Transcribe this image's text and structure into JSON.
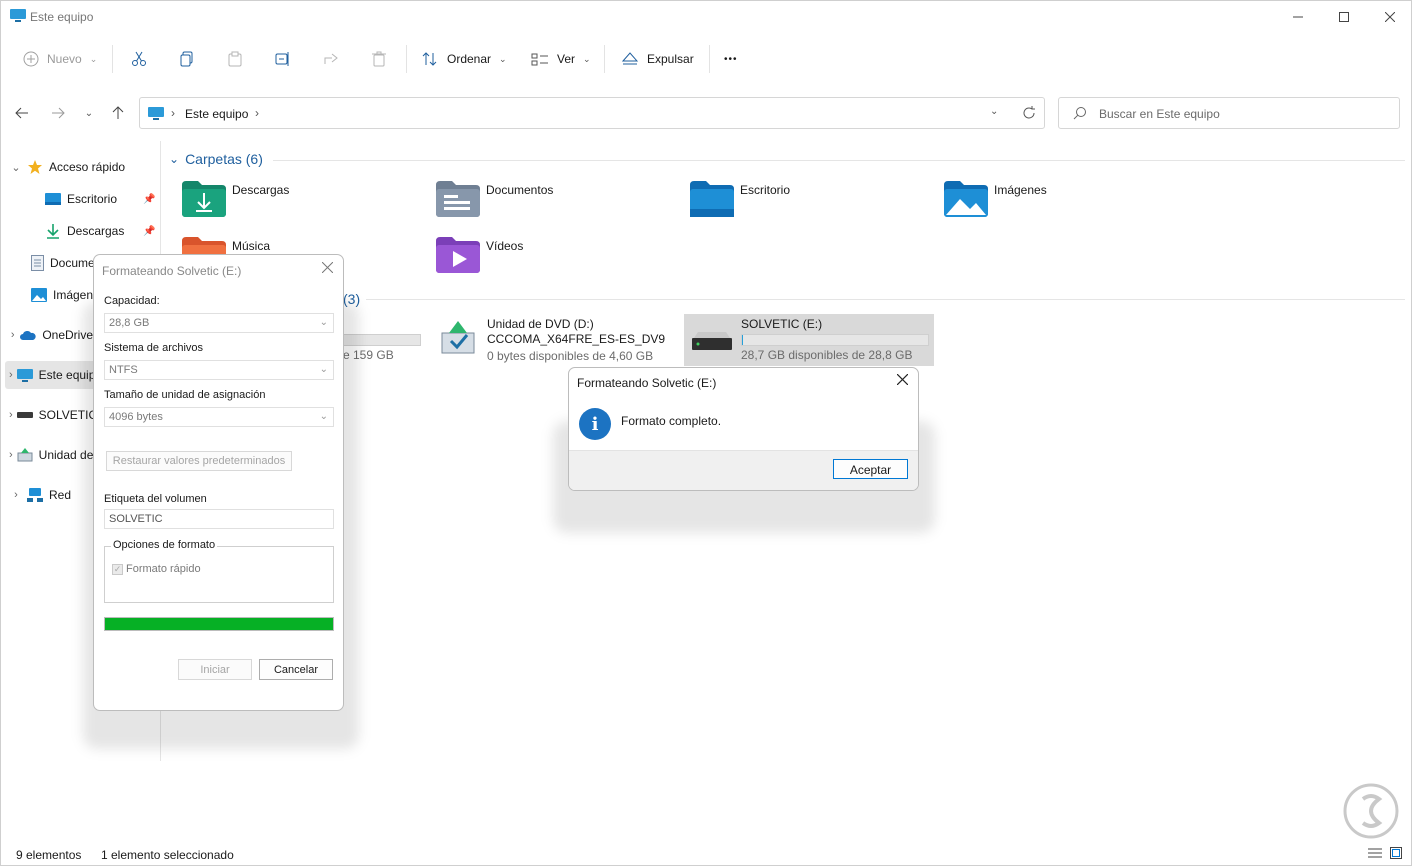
{
  "window": {
    "title": "Este equipo",
    "minimize": "—",
    "maximize": "☐",
    "close": "✕"
  },
  "toolbar": {
    "new_label": "Nuevo",
    "sort_label": "Ordenar",
    "view_label": "Ver",
    "eject_label": "Expulsar",
    "more_label": "•••"
  },
  "address": {
    "crumbs": [
      "Este equipo"
    ],
    "search_placeholder": "Buscar en Este equipo"
  },
  "nav": {
    "quick_access": "Acceso rápido",
    "items": [
      {
        "label": "Escritorio",
        "pinned": true
      },
      {
        "label": "Descargas",
        "pinned": true
      },
      {
        "label": "Documentos"
      },
      {
        "label": "Imágenes"
      }
    ],
    "onedrive": "OneDrive",
    "this_pc": "Este equipo",
    "solvetic": "SOLVETIC (E:)",
    "dvd": "Unidad de DVD (D:) CCCOMA_X64FRE_ES-ES_DV9",
    "network": "Red"
  },
  "content": {
    "folders_header": "Carpetas (6)",
    "folders": [
      {
        "name": "Descargas",
        "icon": "downloads-folder-icon"
      },
      {
        "name": "Documentos",
        "icon": "documents-folder-icon"
      },
      {
        "name": "Escritorio",
        "icon": "desktop-folder-icon"
      },
      {
        "name": "Imágenes",
        "icon": "pictures-folder-icon"
      },
      {
        "name": "Música",
        "icon": "music-folder-icon"
      },
      {
        "name": "Vídeos",
        "icon": "videos-folder-icon"
      }
    ],
    "drives_header_count": "(3)",
    "drives": [
      {
        "line1": "",
        "line2": "",
        "sub": "e 159 GB",
        "used_fraction": 0.5
      },
      {
        "line1": "Unidad de DVD (D:)",
        "line2": "CCCOMA_X64FRE_ES-ES_DV9",
        "sub": "0 bytes disponibles de 4,60 GB"
      },
      {
        "line1": "SOLVETIC (E:)",
        "sub": "28,7 GB disponibles de 28,8 GB",
        "used_fraction": 0.004
      }
    ]
  },
  "format_dialog": {
    "title": "Formateando Solvetic (E:)",
    "capacity_label": "Capacidad:",
    "capacity_value": "28,8 GB",
    "fs_label": "Sistema de archivos",
    "fs_value": "NTFS",
    "alloc_label": "Tamaño de unidad de asignación",
    "alloc_value": "4096 bytes",
    "restore_button": "Restaurar valores predeterminados",
    "volume_label": "Etiqueta del volumen",
    "volume_value": "SOLVETIC",
    "options_label": "Opciones de formato",
    "quick_format": "Formato rápido",
    "progress_fraction": 1.0,
    "start_button": "Iniciar",
    "cancel_button": "Cancelar"
  },
  "message_box": {
    "title": "Formateando Solvetic (E:)",
    "text": "Formato completo.",
    "ok_button": "Aceptar",
    "icon": "info-icon"
  },
  "status": {
    "items": "9 elementos",
    "selected": "1 elemento seleccionado"
  },
  "colors": {
    "accent": "#0078d4",
    "progress": "#06b025",
    "drive_bar": "#26a0da"
  }
}
